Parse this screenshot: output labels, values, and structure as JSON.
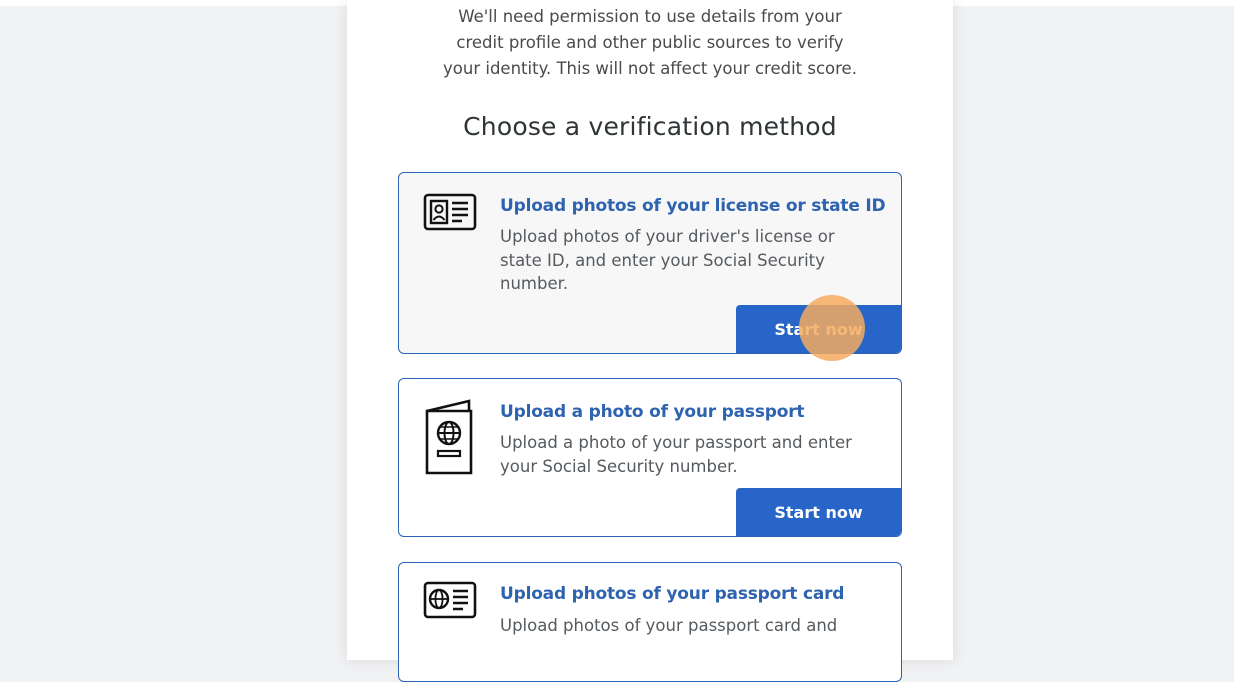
{
  "intro_text": "We'll need permission to use details from your\ncredit profile and other public sources to verify\nyour identity. This will not affect your credit score.",
  "heading": "Choose a verification method",
  "methods": [
    {
      "icon": "id-card-icon",
      "title": "Upload photos of your license or state ID",
      "description": "Upload photos of your driver's license or state ID, and enter your Social Security number.",
      "button": "Start now"
    },
    {
      "icon": "passport-icon",
      "title": "Upload a photo of your passport",
      "description": "Upload a photo of your passport and enter your Social Security number.",
      "button": "Start now"
    },
    {
      "icon": "passport-card-icon",
      "title": "Upload photos of your passport card",
      "description": "Upload photos of your passport card and"
    }
  ],
  "colors": {
    "accent": "#2766c8",
    "title_blue": "#2e63b0",
    "click_marker": "#f5aa5f"
  }
}
